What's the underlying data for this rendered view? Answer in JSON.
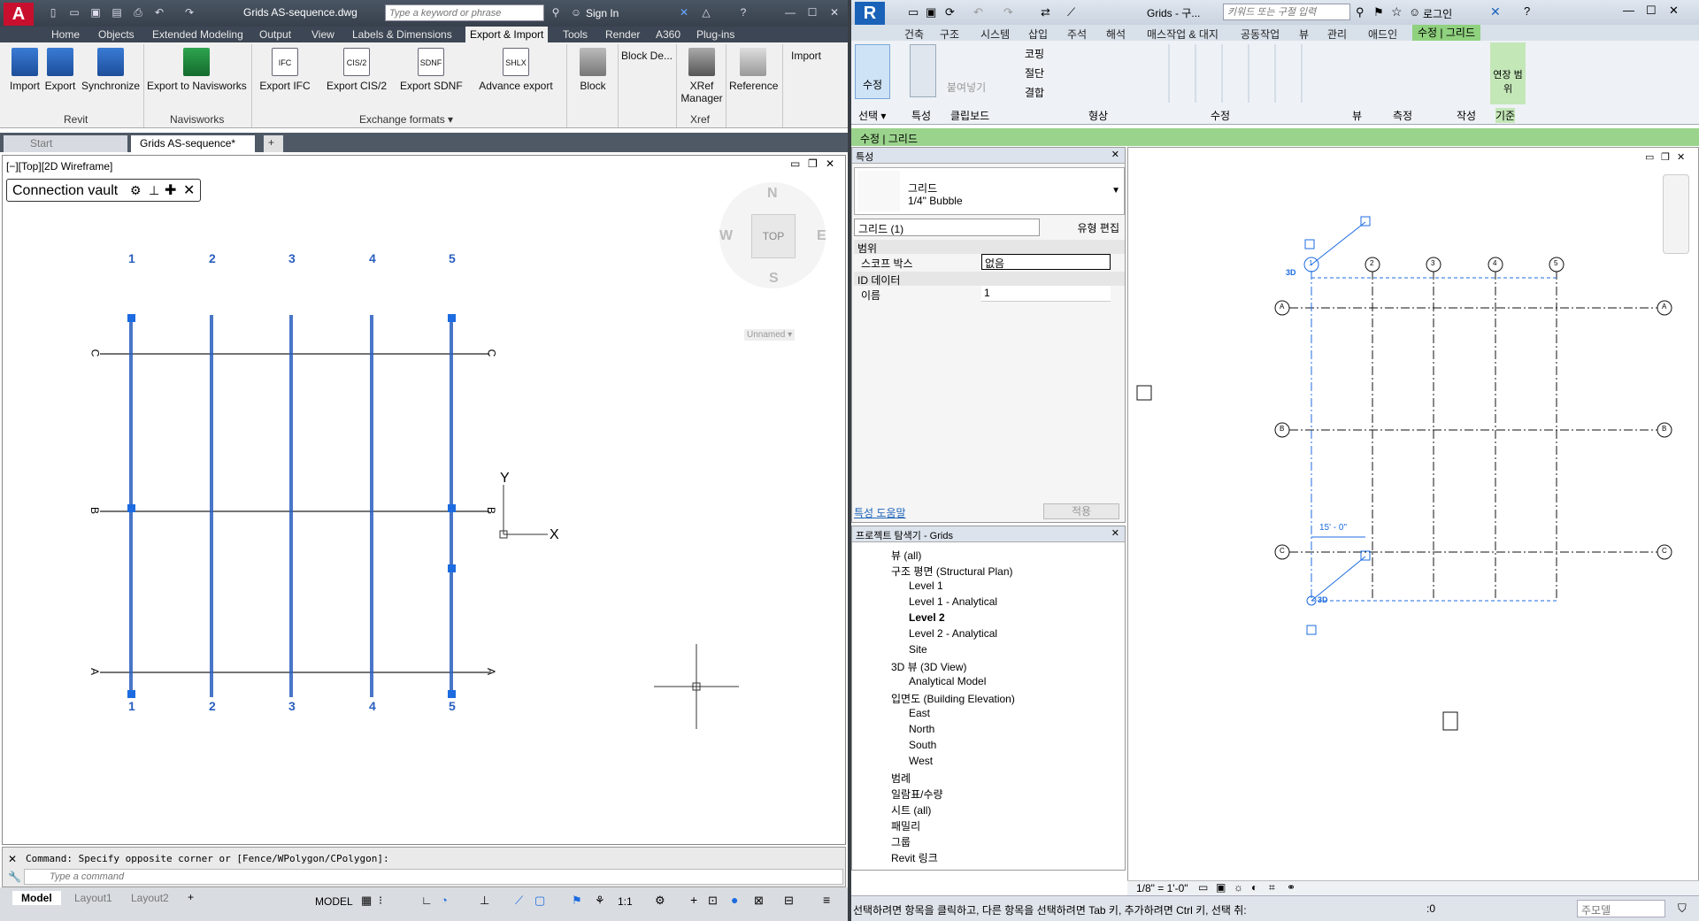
{
  "autocad": {
    "title": "Grids AS-sequence.dwg",
    "search_placeholder": "Type a keyword or phrase",
    "sign_in": "Sign In",
    "tabs": [
      "Home",
      "Objects",
      "Extended Modeling",
      "Output",
      "View",
      "Labels & Dimensions",
      "Export & Import",
      "Tools",
      "Render",
      "A360",
      "Plug-ins"
    ],
    "ribbon": {
      "import": "Import",
      "export": "Export",
      "synchronize": "Synchronize",
      "export_navisworks": "Export to Navisworks",
      "export_ifc": "Export IFC",
      "export_cis2": "Export CIS/2",
      "export_sdnf": "Export SDNF",
      "advance_export": "Advance export",
      "block": "Block",
      "block_de": "Block De...",
      "xref_manager": "XRef Manager",
      "reference": "Reference",
      "import2": "Import",
      "panel_revit": "Revit",
      "panel_navisworks": "Navisworks",
      "panel_exchange": "Exchange formats ▾",
      "panel_xref": "Xref",
      "icon_ifc": "IFC",
      "icon_cis2": "CIS/2",
      "icon_sdnf": "SDNF",
      "icon_shlx": "SHLX"
    },
    "doc_tabs": [
      "Start",
      "Grids AS-sequence*"
    ],
    "view_label": "[−][Top][2D Wireframe]",
    "connection_vault": "Connection vault",
    "viewcube": {
      "n": "N",
      "s": "S",
      "e": "E",
      "w": "W",
      "top": "TOP",
      "ucs": "Unnamed ▾"
    },
    "grid_numbers": [
      "1",
      "2",
      "3",
      "4",
      "5"
    ],
    "grid_letters": [
      "C",
      "B",
      "A"
    ],
    "axes": {
      "y": "Y",
      "x": "X"
    },
    "command_history": "Command: Specify opposite corner or [Fence/WPolygon/CPolygon]:",
    "command_placeholder": "Type a command",
    "layout_tabs": [
      "Model",
      "Layout1",
      "Layout2"
    ],
    "status": {
      "model": "MODEL",
      "scale": "1:1"
    }
  },
  "revit": {
    "title": "Grids - 구...",
    "search_placeholder": "키워드 또는 구절 입력",
    "login": "로그인",
    "tabs": [
      "건축",
      "구조",
      "시스템",
      "삽입",
      "주석",
      "해석",
      "매스작업 & 대지",
      "공동작업",
      "뷰",
      "관리",
      "애드인",
      "수정 | 그리드"
    ],
    "ribbon": {
      "modify": "수정",
      "select": "선택 ▾",
      "properties": "특성",
      "clipboard": "클립보드",
      "paste": "붙여넣기",
      "cope": "코핑",
      "cut": "절단",
      "join": "결합",
      "geometry": "형상",
      "modify_panel": "수정",
      "view": "뷰",
      "measure": "측정",
      "create": "작성",
      "extend": "연장 범위",
      "datum": "기준"
    },
    "subheader": "수정 | 그리드",
    "properties": {
      "header": "특성",
      "type_name": "그리드",
      "type_sub": "1/4\" Bubble",
      "selector": "그리드 (1)",
      "edit_type": "유형 편집",
      "cat_extents": "범위",
      "scope_box_label": "스코프 박스",
      "scope_box_value": "없음",
      "cat_identity": "ID 데이터",
      "name_label": "이름",
      "name_value": "1",
      "help_link": "특성 도움말",
      "apply": "적용"
    },
    "browser": {
      "header": "프로젝트 탐색기 - Grids",
      "views_all": "뷰 (all)",
      "structural_plan": "구조 평면 (Structural Plan)",
      "level1": "Level 1",
      "level1_an": "Level 1 - Analytical",
      "level2": "Level 2",
      "level2_an": "Level 2 - Analytical",
      "site": "Site",
      "view3d": "3D 뷰 (3D View)",
      "analytical_model": "Analytical Model",
      "elevation": "입면도 (Building Elevation)",
      "east": "East",
      "north": "North",
      "south": "South",
      "west": "West",
      "legends": "범례",
      "schedules": "일람표/수량",
      "sheets": "시트 (all)",
      "families": "패밀리",
      "groups": "그룹",
      "revit_links": "Revit 링크"
    },
    "grid_numbers": [
      "1",
      "2",
      "3",
      "4",
      "5"
    ],
    "grid_letters": [
      "A",
      "B",
      "C"
    ],
    "dimension": "15' - 0\"",
    "label_3d": "3D",
    "view_scale": "1/8\" = 1'-0\"",
    "status_text": "선택하려면 항목을 클릭하고, 다른 항목을 선택하려면 Tab 키, 추가하려면 Ctrl 키, 선택 취:",
    "status_zero": ":0",
    "status_model": "주모델"
  }
}
